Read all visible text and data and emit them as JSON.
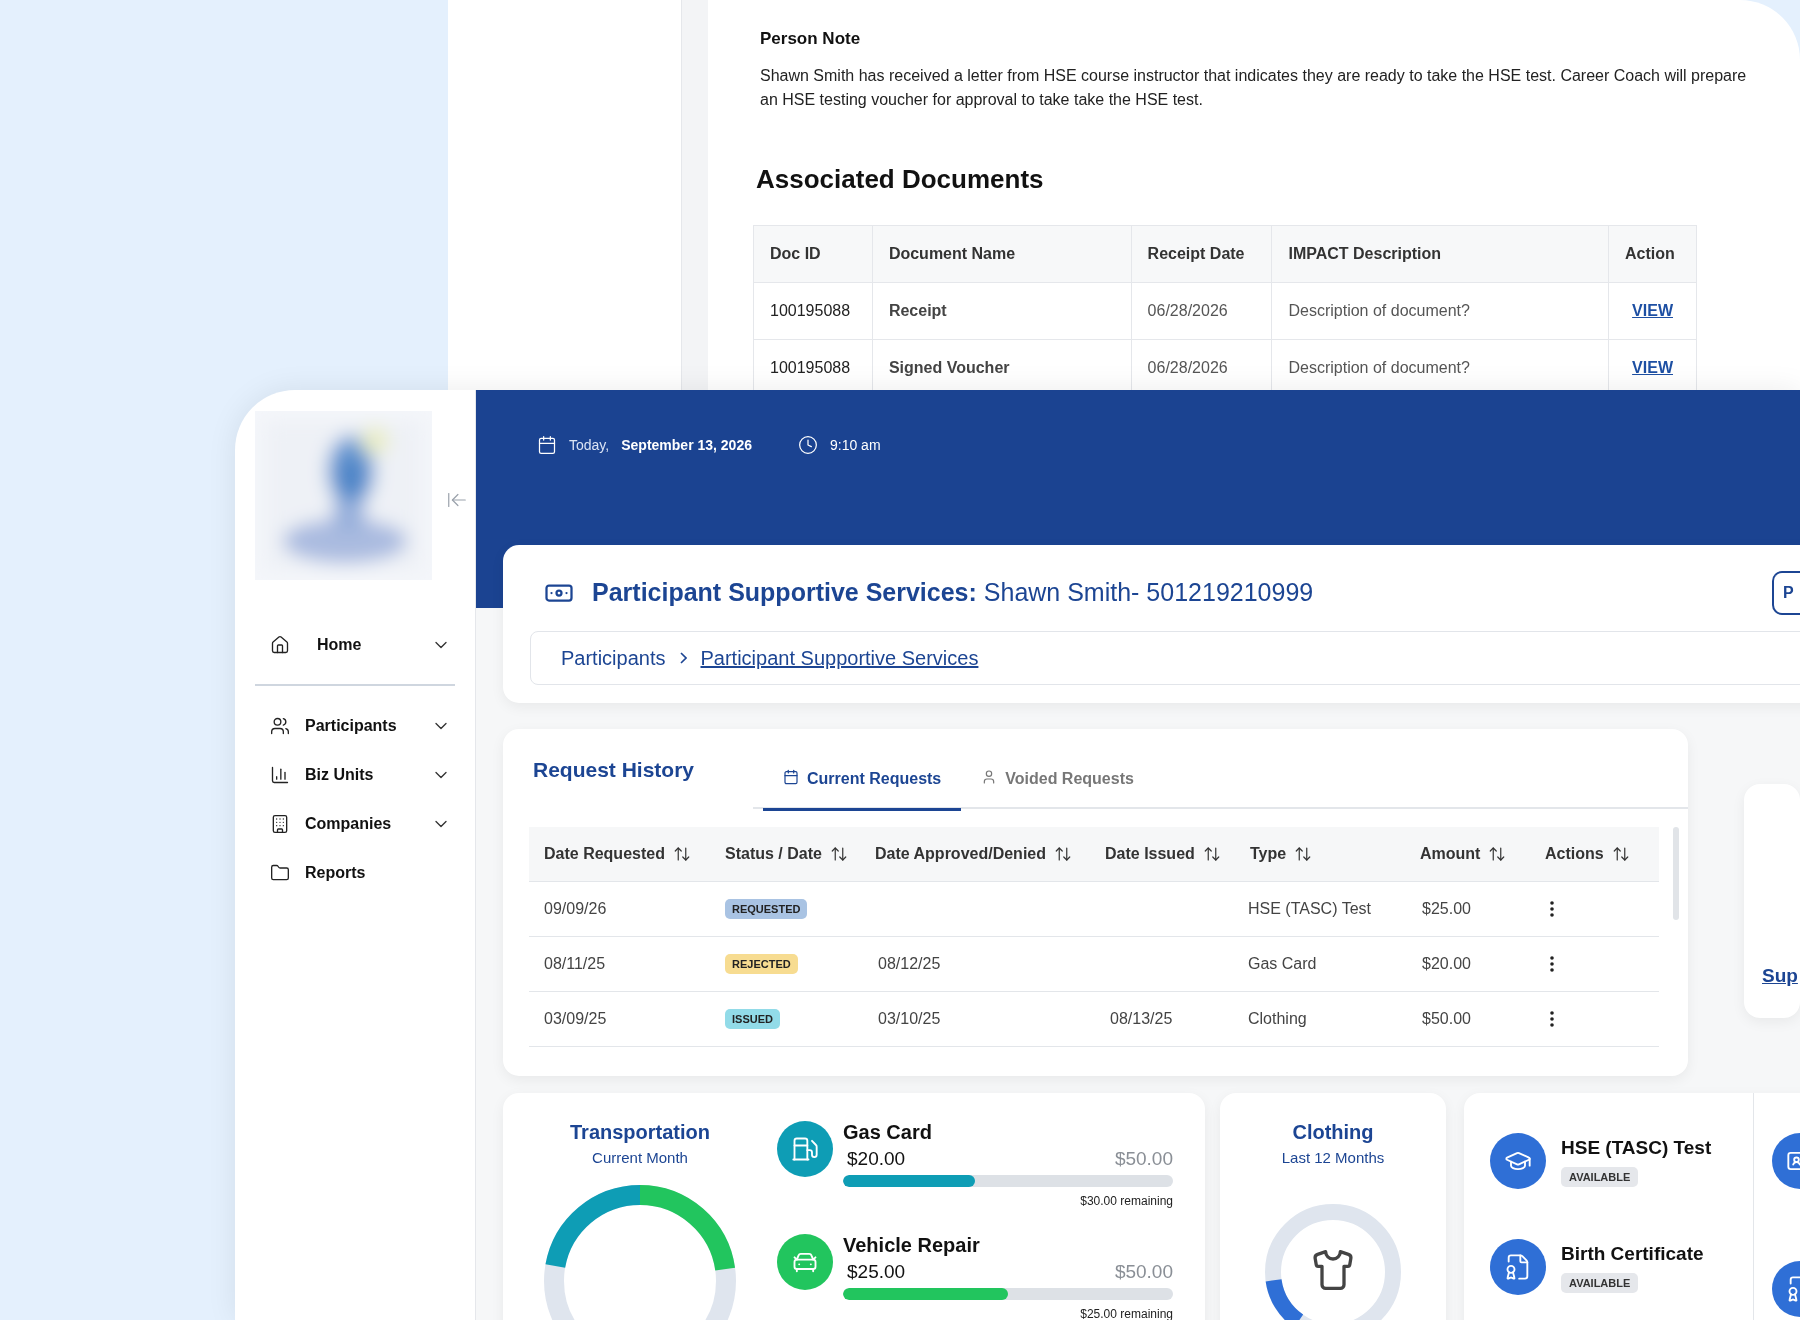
{
  "documents_panel": {
    "note_title": "Person Note",
    "note_text": "Shawn Smith has received a letter from HSE course instructor that indicates they are ready to take the HSE test. Career Coach will prepare an HSE testing voucher for approval to take take the HSE test.",
    "section_title": "Associated Documents",
    "columns": [
      "Doc ID",
      "Document Name",
      "Receipt Date",
      "IMPACT Description",
      "Action"
    ],
    "rows": [
      {
        "doc_id": "100195088",
        "name": "Receipt",
        "date": "06/28/2026",
        "description": "Description of document?",
        "action": "VIEW"
      },
      {
        "doc_id": "100195088",
        "name": "Signed Voucher",
        "date": "06/28/2026",
        "description": "Description of document?",
        "action": "VIEW"
      }
    ]
  },
  "sidebar": {
    "items": [
      {
        "kind": "home",
        "label": "Home",
        "expandable": true
      },
      {
        "kind": "people",
        "label": "Participants",
        "expandable": true
      },
      {
        "kind": "chart",
        "label": "Biz Units",
        "expandable": true
      },
      {
        "kind": "building",
        "label": "Companies",
        "expandable": true
      },
      {
        "kind": "folder",
        "label": "Reports",
        "expandable": false
      }
    ]
  },
  "header": {
    "date_prefix": "Today,",
    "date": "September 13, 2026",
    "time": "9:10 am"
  },
  "title_card": {
    "title": "Participant Supportive Services:",
    "subject": "Shawn Smith- 501219210999",
    "button": "P",
    "breadcrumbs": [
      {
        "label": "Participants",
        "current": false
      },
      {
        "label": "Participant Supportive Services",
        "current": true
      }
    ]
  },
  "request_history": {
    "title": "Request History",
    "tabs": [
      {
        "kind": "calendar",
        "label": "Current Requests",
        "selected": true
      },
      {
        "kind": "person",
        "label": "Voided Requests",
        "selected": false
      }
    ],
    "columns": [
      "Date Requested",
      "Status / Date",
      "Date Approved/Denied",
      "Date Issued",
      "Type",
      "Amount",
      "Actions"
    ],
    "rows": [
      {
        "date_requested": "09/09/26",
        "status": "REQUESTED",
        "color": "#a9c3e3",
        "date_decided": "",
        "date_issued": "",
        "type": "HSE (TASC) Test",
        "amount": "$25.00"
      },
      {
        "date_requested": "08/11/25",
        "status": "REJECTED",
        "color": "#f7dc91",
        "date_decided": "08/12/25",
        "date_issued": "",
        "type": "Gas Card",
        "amount": "$20.00"
      },
      {
        "date_requested": "03/09/25",
        "status": "ISSUED",
        "color": "#92dbe8",
        "date_decided": "03/10/25",
        "date_issued": "08/13/25",
        "type": "Clothing",
        "amount": "$50.00"
      }
    ]
  },
  "side_card": {
    "link": "Sup"
  },
  "transportation": {
    "title": "Transportation",
    "subtitle": "Current Month",
    "items": [
      {
        "kind": "fuel",
        "name": "Gas Card",
        "amount": "$20.00",
        "limit": "$50.00",
        "level": 0.4,
        "remaining": "$30.00 remaining",
        "color": "#0e9db5"
      },
      {
        "kind": "car",
        "name": "Vehicle Repair",
        "amount": "$25.00",
        "limit": "$50.00",
        "level": 0.5,
        "remaining": "$25.00 remaining",
        "color": "#22c55e"
      }
    ]
  },
  "clothing": {
    "title": "Clothing",
    "subtitle": "Last 12 Months"
  },
  "documents": {
    "items": [
      {
        "kind": "graduation",
        "name": "HSE (TASC) Test",
        "status": "AVAILABLE"
      },
      {
        "kind": "certificate",
        "name": "Birth Certificate",
        "status": "AVAILABLE"
      }
    ]
  }
}
